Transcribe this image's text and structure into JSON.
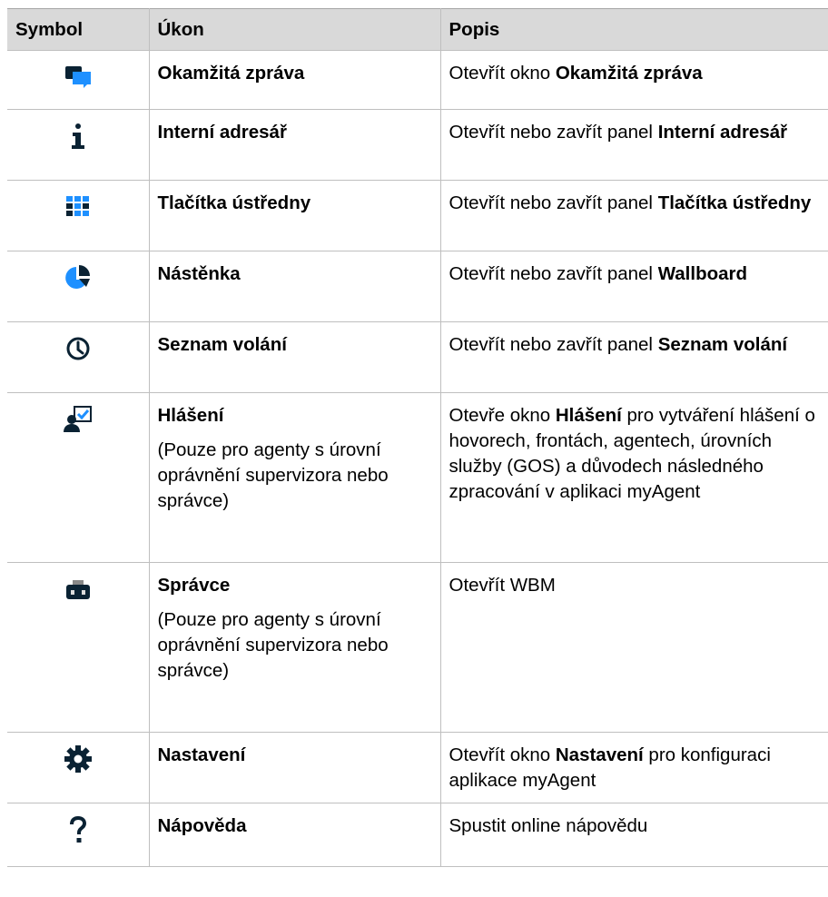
{
  "table": {
    "headers": [
      "Symbol",
      "Úkon",
      "Popis"
    ],
    "rows": [
      {
        "icon": "chat-bubbles-icon",
        "action": "Okamžitá zpráva",
        "desc": {
          "pre": "Otevřít okno ",
          "bold": "Okamžitá zpráva",
          "post": ""
        }
      },
      {
        "icon": "info-icon",
        "action": "Interní adresář",
        "desc": {
          "pre": "Otevřít nebo zavřít panel ",
          "bold": "Interní adresář",
          "post": ""
        }
      },
      {
        "icon": "keypad-grid-icon",
        "action": "Tlačítka ústředny",
        "desc": {
          "pre": "Otevřít nebo zavřít panel ",
          "bold": "Tlačítka ústředny",
          "post": ""
        }
      },
      {
        "icon": "pie-chart-icon",
        "action": "Nástěnka",
        "desc": {
          "pre": "Otevřít nebo zavřít panel ",
          "bold": "Wallboard",
          "post": ""
        }
      },
      {
        "icon": "clock-icon",
        "action": "Seznam volání",
        "desc": {
          "pre": "Otevřít nebo zavřít panel ",
          "bold": "Seznam volání",
          "post": ""
        }
      },
      {
        "icon": "report-user-icon",
        "action": "Hlášení",
        "note": "(Pouze pro agenty s úrovní oprávnění supervizora nebo správce)",
        "desc": {
          "pre": "Otevře okno ",
          "bold": "Hlášení",
          "post": " pro vytváření hlášení o hovorech, frontách, agentech, úrovních služby (GOS) a důvodech následného zpracování v aplikaci myAgent"
        }
      },
      {
        "icon": "toolbox-icon",
        "action": "Správce",
        "note": "(Pouze pro agenty s úrovní oprávnění supervizora nebo správce)",
        "desc": {
          "pre": "Otevřít WBM",
          "bold": "",
          "post": ""
        }
      },
      {
        "icon": "gear-icon",
        "action": "Nastavení",
        "desc": {
          "pre": "Otevřít okno ",
          "bold": "Nastavení",
          "post": " pro konfiguraci aplikace myAgent"
        }
      },
      {
        "icon": "question-mark-icon",
        "action": "Nápověda",
        "desc": {
          "pre": "Spustit online nápovědu",
          "bold": "",
          "post": ""
        }
      }
    ]
  },
  "colors": {
    "accent_blue": "#1e90ff",
    "header_bg": "#d9d9d9",
    "border": "#bfbfbf"
  }
}
